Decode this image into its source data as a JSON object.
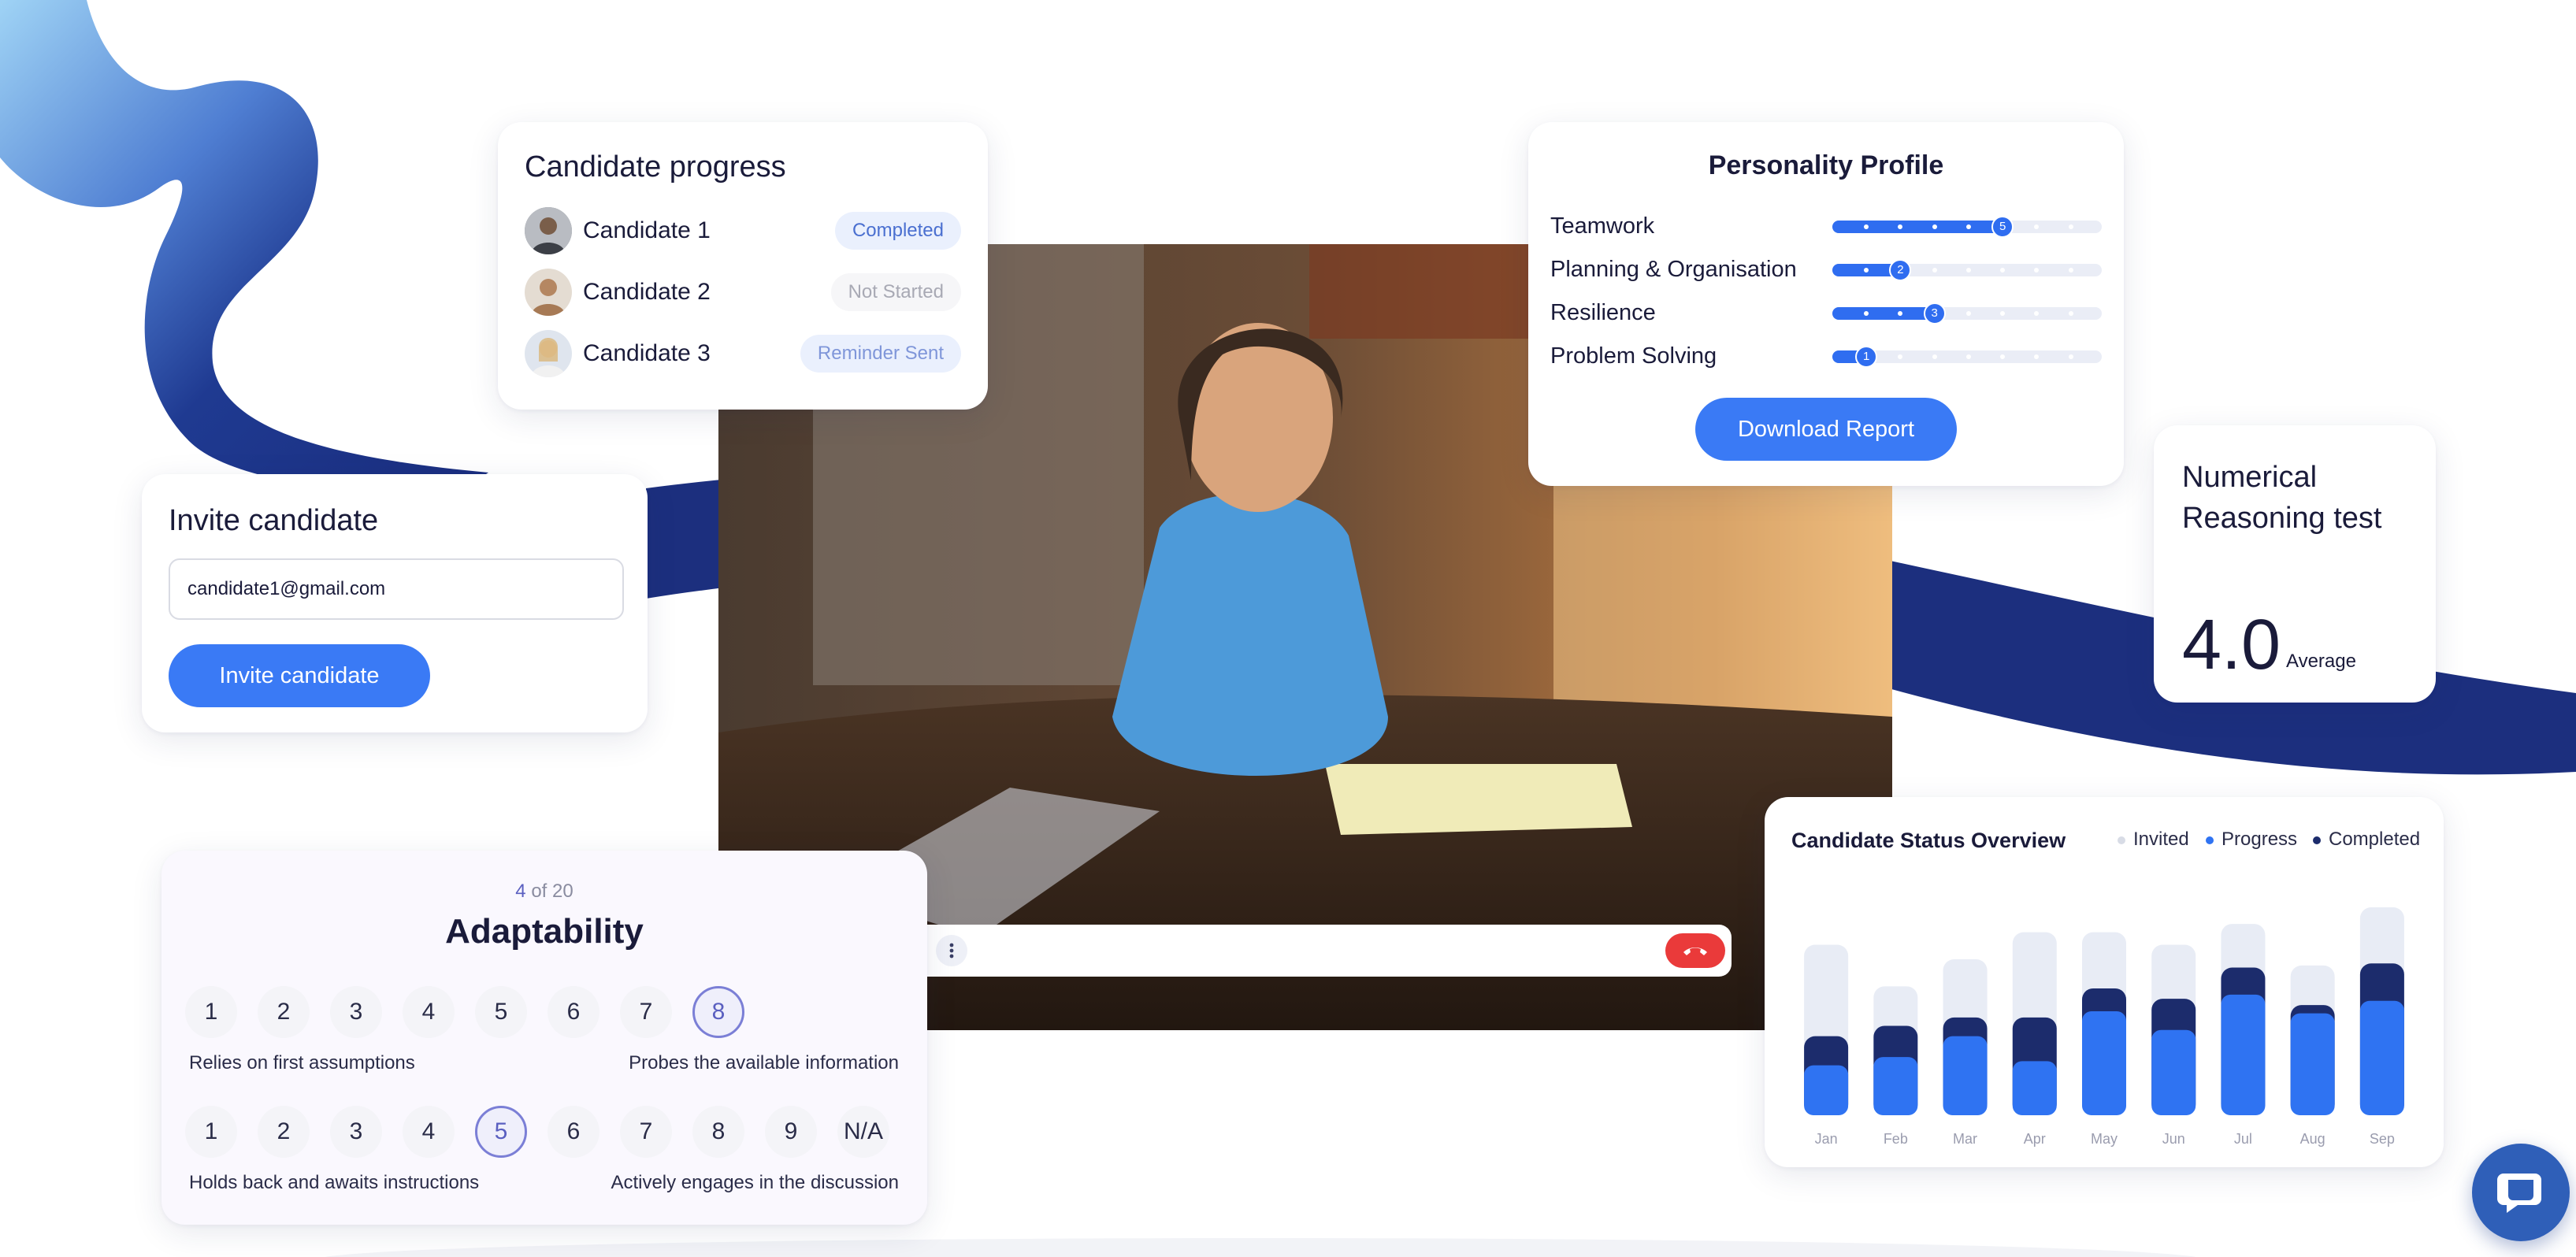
{
  "candidate_progress": {
    "title": "Candidate progress",
    "candidates": [
      {
        "name": "Candidate 1",
        "status": "Completed",
        "status_color": "#4a6fd0",
        "badge_bg": "#eaf0fd"
      },
      {
        "name": "Candidate 2",
        "status": "Not Started",
        "status_color": "#a8a9b4",
        "badge_bg": "#f6f6f8"
      },
      {
        "name": "Candidate 3",
        "status": "Reminder Sent",
        "status_color": "#7f96d9",
        "badge_bg": "#eaf0fd"
      }
    ]
  },
  "personality_profile": {
    "title": "Personality Profile",
    "max_level": 7,
    "traits": [
      {
        "label": "Teamwork",
        "level": 5
      },
      {
        "label": "Planning & Organisation",
        "level": 2
      },
      {
        "label": "Resilience",
        "level": 3
      },
      {
        "label": "Problem Solving",
        "level": 1
      }
    ],
    "button_label": "Download Report"
  },
  "invite": {
    "title": "Invite candidate",
    "email_value": "candidate1@gmail.com",
    "button_label": "Invite candidate"
  },
  "numerical": {
    "title_line1": "Numerical",
    "title_line2": "Reasoning test",
    "value": "4.0",
    "value_label": "Average"
  },
  "adaptability": {
    "counter_current": "4",
    "counter_rest": " of 20",
    "title": "Adaptability",
    "scale1": {
      "options": [
        "1",
        "2",
        "3",
        "4",
        "5",
        "6",
        "7",
        "8"
      ],
      "selected": "8",
      "left_label": "Relies on first assumptions",
      "right_label": "Probes the available information"
    },
    "scale2": {
      "options": [
        "1",
        "2",
        "3",
        "4",
        "5",
        "6",
        "7",
        "8",
        "9",
        "N/A"
      ],
      "selected": "5",
      "left_label": "Holds back and awaits instructions",
      "right_label": "Actively engages in the discussion"
    }
  },
  "video_call": {
    "controls": [
      "mic-icon",
      "camera-icon",
      "raise-hand-icon",
      "more-icon"
    ],
    "end_call_color": "#ea3a3a"
  },
  "colors": {
    "accent": "#3a7af5",
    "navy": "#1c2f7e",
    "progress_blue": "#2f73f2",
    "completed_navy": "#1c2c6c",
    "invited_gray": "#e8ecf5"
  },
  "chart_data": {
    "type": "bar",
    "title": "Candidate Status Overview",
    "legend_position": "top-right",
    "grid": false,
    "categories": [
      "Jan",
      "Feb",
      "Mar",
      "Apr",
      "May",
      "Jun",
      "Jul",
      "Aug",
      "Sep"
    ],
    "ylim": [
      0,
      100
    ],
    "series": [
      {
        "name": "Invited",
        "color": "#e8ecf5",
        "values": [
          82,
          62,
          75,
          88,
          88,
          82,
          92,
          72,
          100
        ]
      },
      {
        "name": "Progress",
        "color": "#2f73f2",
        "values": [
          24,
          28,
          38,
          26,
          50,
          41,
          58,
          49,
          55
        ]
      },
      {
        "name": "Completed",
        "color": "#1c2c6c",
        "values": [
          14,
          15,
          9,
          21,
          11,
          15,
          13,
          4,
          18
        ]
      }
    ]
  }
}
